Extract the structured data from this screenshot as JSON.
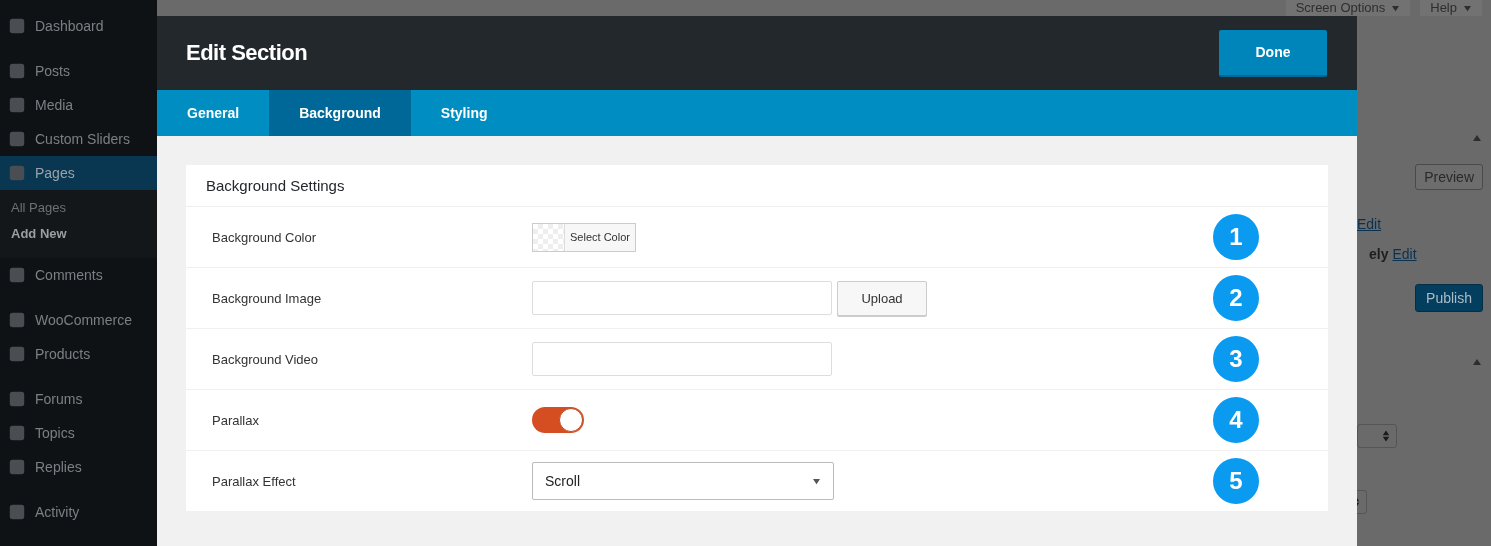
{
  "sidebar": {
    "groups": [
      {
        "items": [
          {
            "label": "Dashboard",
            "selected": false
          }
        ]
      },
      {
        "items": [
          {
            "label": "Posts",
            "selected": false
          },
          {
            "label": "Media",
            "selected": false
          },
          {
            "label": "Custom Sliders",
            "selected": false
          },
          {
            "label": "Pages",
            "selected": true,
            "children": [
              {
                "label": "All Pages",
                "selected": false
              },
              {
                "label": "Add New",
                "selected": true
              }
            ]
          },
          {
            "label": "Comments",
            "selected": false
          }
        ]
      },
      {
        "items": [
          {
            "label": "WooCommerce",
            "selected": false
          },
          {
            "label": "Products",
            "selected": false
          }
        ]
      },
      {
        "items": [
          {
            "label": "Forums",
            "selected": false
          },
          {
            "label": "Topics",
            "selected": false
          },
          {
            "label": "Replies",
            "selected": false
          }
        ]
      },
      {
        "items": [
          {
            "label": "Activity",
            "selected": false
          }
        ]
      }
    ]
  },
  "header_buttons": [
    "Screen Options",
    "Help"
  ],
  "publish_box": {
    "preview": "Preview",
    "edit_lines": [
      {
        "link": "Edit"
      },
      {
        "before": "ely",
        "link": "Edit"
      }
    ],
    "publish": "Publish"
  },
  "modal": {
    "title": "Edit Section",
    "done": "Done",
    "tabs": [
      {
        "label": "General",
        "selected": false
      },
      {
        "label": "Background",
        "selected": true
      },
      {
        "label": "Styling",
        "selected": false
      }
    ],
    "panel": {
      "heading": "Background Settings",
      "rows": [
        {
          "kind": "color",
          "label": "Background Color",
          "button": "Select Color",
          "marker": "1"
        },
        {
          "kind": "image",
          "label": "Background Image",
          "button": "Upload",
          "marker": "2"
        },
        {
          "kind": "video",
          "label": "Background Video",
          "marker": "3"
        },
        {
          "kind": "toggle",
          "label": "Parallax",
          "on": true,
          "marker": "4"
        },
        {
          "kind": "select",
          "label": "Parallax Effect",
          "value": "Scroll",
          "marker": "5"
        }
      ]
    }
  }
}
